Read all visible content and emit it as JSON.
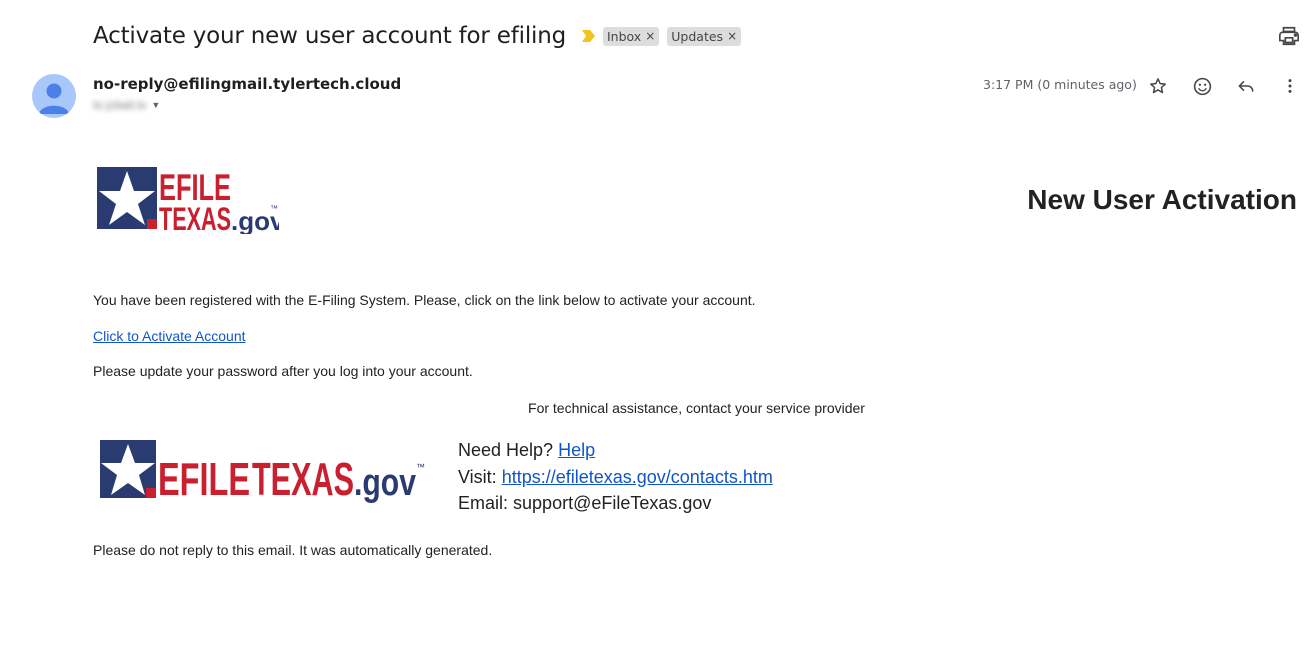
{
  "email": {
    "subject": "Activate your new user account for efiling",
    "labels": [
      {
        "name": "Inbox",
        "close": "×"
      },
      {
        "name": "Updates",
        "close": "×"
      }
    ],
    "sender": "no-reply@efilingmail.tylertech.cloud",
    "recipient": "to jcbail.tx",
    "timestamp": "3:17 PM (0 minutes ago)",
    "importance_color": "#f2c41f"
  },
  "body": {
    "logo_top": {
      "line1": "EFILE",
      "line2": "TEXAS",
      "suffix": ".gov",
      "tm": "™"
    },
    "activation_title": "New User Activation",
    "registered_text": "You have been registered with the E-Filing System. Please, click on the link below to activate your account.",
    "activate_link": "Click to Activate Account",
    "update_password_text": "Please update your password after you log into your account.",
    "tech_assist_text": "For technical assistance, contact your service provider",
    "logo_bottom": {
      "efile": "EFILE",
      "texas": "TEXAS",
      "suffix": ".gov",
      "tm": "™"
    },
    "help": {
      "need_help_label": "Need Help?",
      "help_link": "Help",
      "visit_label": "Visit:",
      "visit_link": "https://efiletexas.gov/contacts.htm",
      "email_label": "Email:",
      "email_value": "support@eFileTexas.gov"
    },
    "footer_text": "Please do not reply to this email. It was automatically generated."
  },
  "colors": {
    "brand_navy": "#2a3b72",
    "brand_red": "#c8202f",
    "link_blue": "#1155cc"
  },
  "icons": [
    "print-icon",
    "star-icon",
    "emoji-icon",
    "reply-icon",
    "more-vert-icon",
    "avatar-icon",
    "importance-icon"
  ]
}
